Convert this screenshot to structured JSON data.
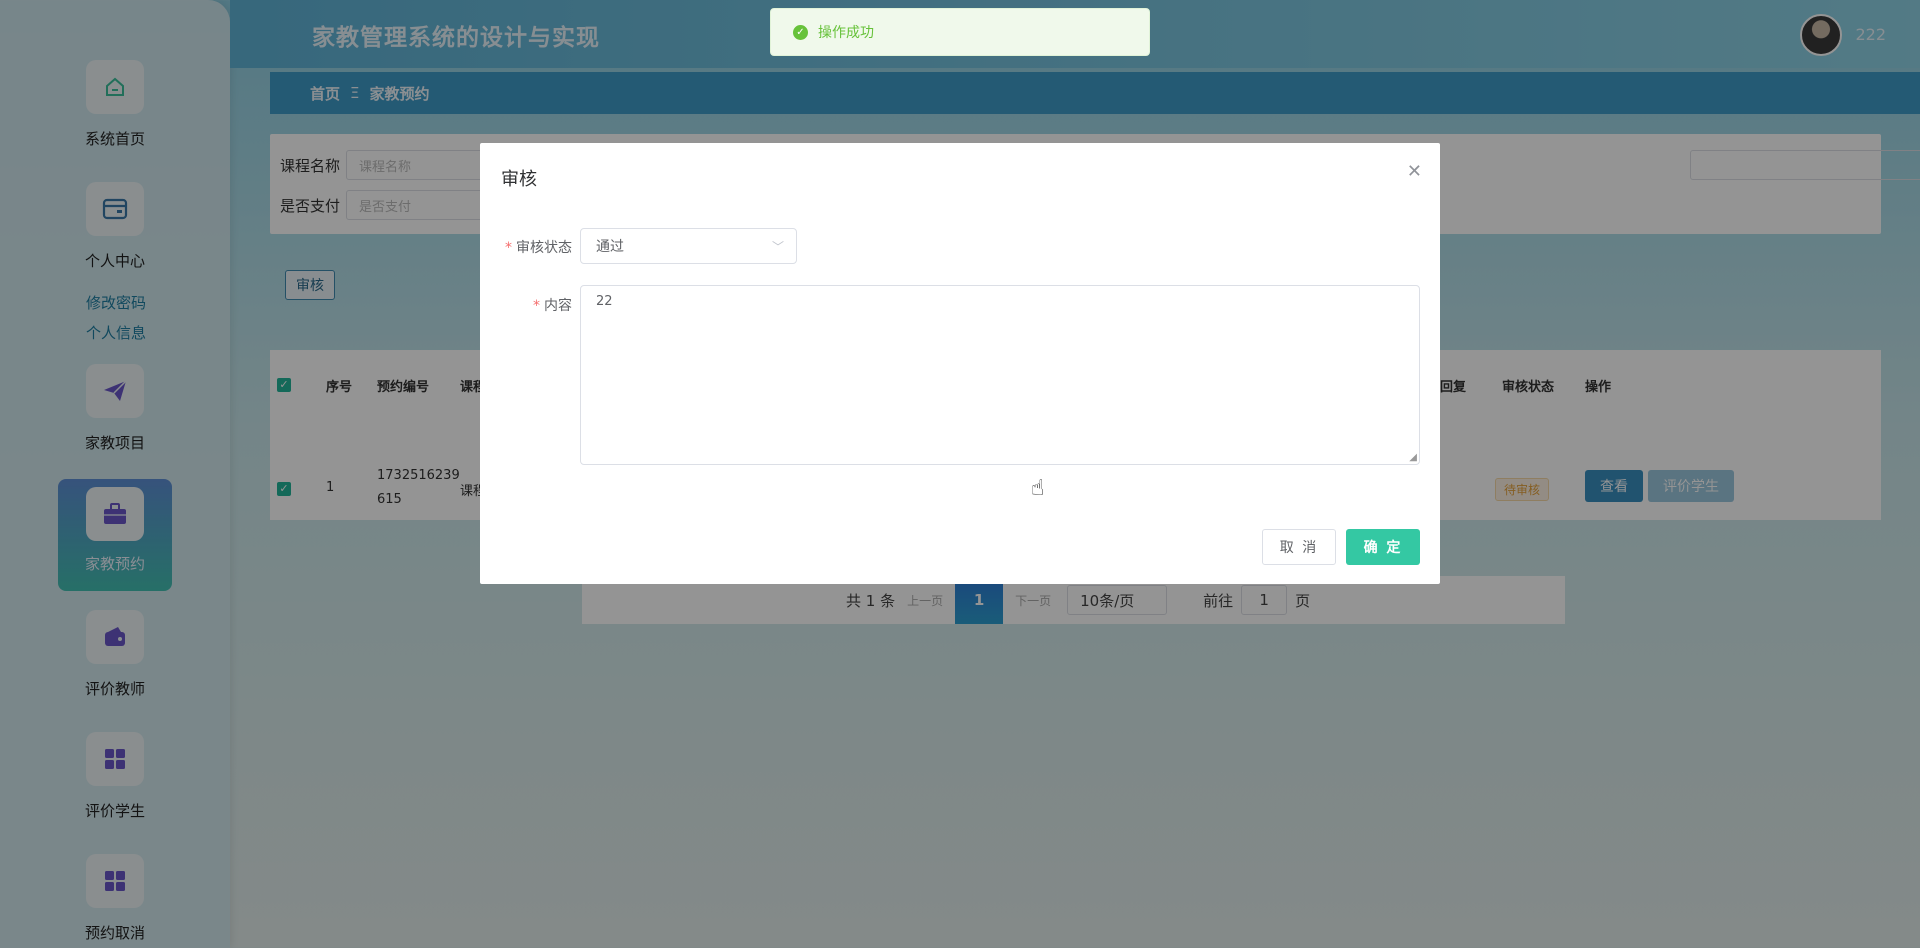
{
  "header": {
    "title": "家教管理系统的设计与实现",
    "username": "222"
  },
  "breadcrumb": {
    "home": "首页",
    "separator": "Ξ",
    "current": "家教预约"
  },
  "sidebar": {
    "items": [
      {
        "label": "系统首页",
        "icon": "home-icon"
      },
      {
        "label": "个人中心",
        "icon": "wallet-icon"
      },
      {
        "label": "家教项目",
        "icon": "send-icon"
      },
      {
        "label": "家教预约",
        "icon": "briefcase-icon",
        "active": true
      },
      {
        "label": "评价教师",
        "icon": "purse-icon"
      },
      {
        "label": "评价学生",
        "icon": "grid-icon"
      },
      {
        "label": "预约取消",
        "icon": "grid-icon"
      }
    ],
    "sub_items": [
      "修改密码",
      "个人信息"
    ]
  },
  "search": {
    "course_label": "课程名称",
    "course_placeholder": "课程名称",
    "paid_label": "是否支付",
    "paid_placeholder": "是否支付"
  },
  "toolbar": {
    "audit_label": "审核"
  },
  "table": {
    "headers": [
      "序号",
      "预约编号",
      "课程",
      "回复",
      "审核状态",
      "操作"
    ],
    "rows": [
      {
        "index": "1",
        "booking_no_1": "1732516239",
        "booking_no_2": "615",
        "course": "课程",
        "status": "待审核",
        "view": "查看",
        "rate": "评价学生"
      }
    ]
  },
  "pagination": {
    "total": "共 1 条",
    "prev": "上一页",
    "current": "1",
    "next": "下一页",
    "page_size": "10条/页",
    "goto_label": "前往",
    "goto_value": "1",
    "page_suffix": "页"
  },
  "toast": {
    "message": "操作成功"
  },
  "dialog": {
    "title": "审核",
    "status_label": "审核状态",
    "status_value": "通过",
    "content_label": "内容",
    "content_value": "22",
    "cancel_label": "取 消",
    "ok_label": "确 定"
  },
  "colors": {
    "accent": "#34c8a3",
    "primary": "#3a8fc0",
    "success": "#67c23a"
  }
}
